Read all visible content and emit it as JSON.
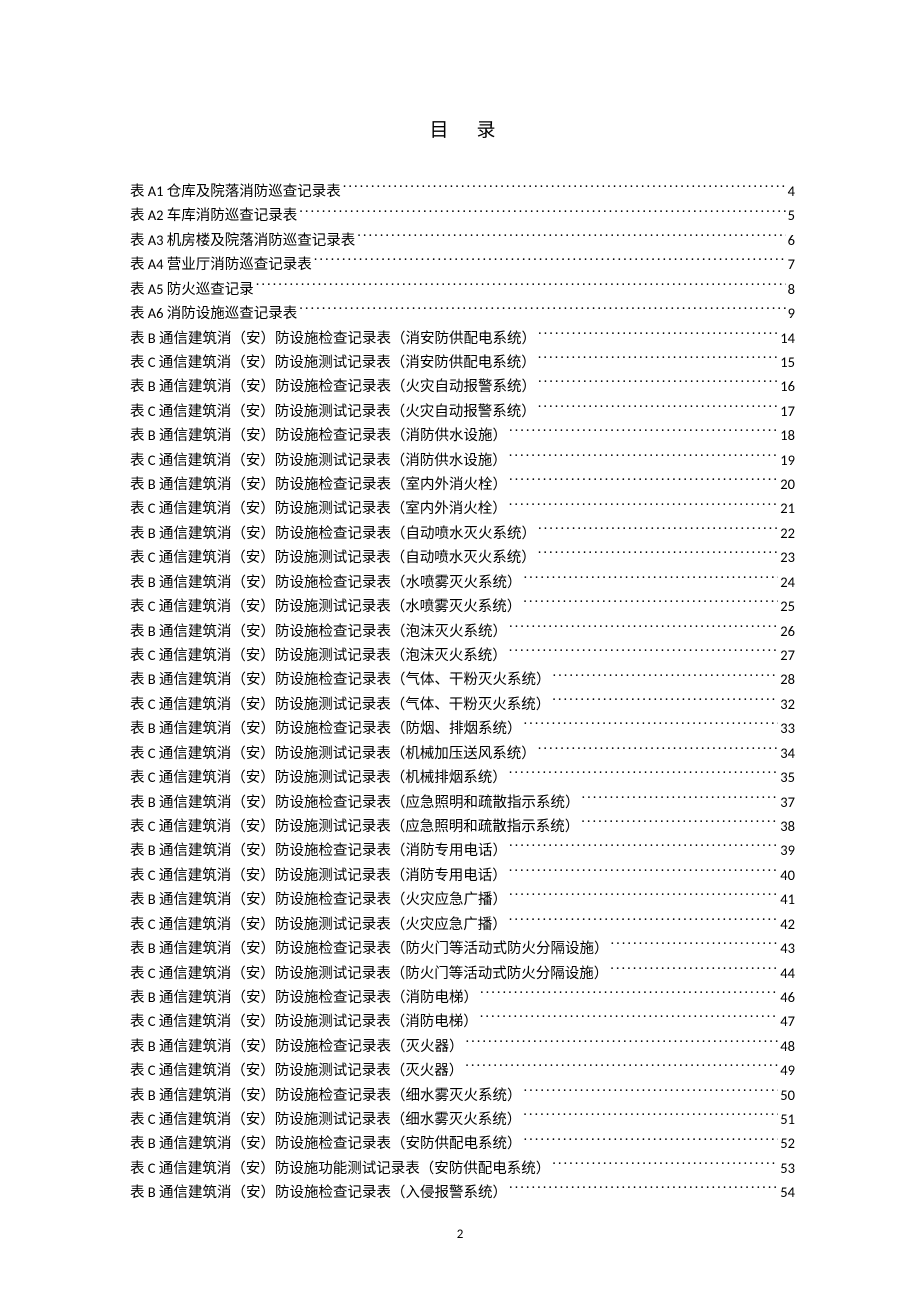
{
  "title": "目录",
  "page_number": "2",
  "toc": [
    {
      "text": "表 A1 仓库及院落消防巡查记录表",
      "page": "4"
    },
    {
      "text": "表 A2 车库消防巡查记录表",
      "page": "5"
    },
    {
      "text": "表 A3 机房楼及院落消防巡查记录表",
      "page": "6"
    },
    {
      "text": "表 A4 营业厅消防巡查记录表",
      "page": "7"
    },
    {
      "text": "表 A5 防火巡查记录",
      "page": "8"
    },
    {
      "text": "表 A6 消防设施巡查记录表",
      "page": "9"
    },
    {
      "text": "表 B 通信建筑消（安）防设施检查记录表（消安防供配电系统）",
      "page": "14"
    },
    {
      "text": "表 C 通信建筑消（安）防设施测试记录表（消安防供配电系统）",
      "page": "15"
    },
    {
      "text": "表 B 通信建筑消（安）防设施检查记录表（火灾自动报警系统）",
      "page": "16"
    },
    {
      "text": "表 C 通信建筑消（安）防设施测试记录表（火灾自动报警系统）",
      "page": "17"
    },
    {
      "text": "表 B 通信建筑消（安）防设施检查记录表（消防供水设施）",
      "page": "18"
    },
    {
      "text": "表 C 通信建筑消（安）防设施测试记录表（消防供水设施）",
      "page": "19"
    },
    {
      "text": "表 B 通信建筑消（安）防设施检查记录表（室内外消火栓）",
      "page": "20"
    },
    {
      "text": "表 C 通信建筑消（安）防设施测试记录表（室内外消火栓）",
      "page": "21"
    },
    {
      "text": "表 B 通信建筑消（安）防设施检查记录表（自动喷水灭火系统）",
      "page": "22"
    },
    {
      "text": "表 C 通信建筑消（安）防设施测试记录表（自动喷水灭火系统）",
      "page": "23"
    },
    {
      "text": "表 B 通信建筑消（安）防设施检查记录表（水喷雾灭火系统）",
      "page": "24"
    },
    {
      "text": "表 C 通信建筑消（安）防设施测试记录表（水喷雾灭火系统）",
      "page": "25"
    },
    {
      "text": "表 B 通信建筑消（安）防设施检查记录表（泡沫灭火系统）",
      "page": "26"
    },
    {
      "text": "表 C 通信建筑消（安）防设施测试记录表（泡沫灭火系统）",
      "page": "27"
    },
    {
      "text": "表 B 通信建筑消（安）防设施检查记录表（气体、干粉灭火系统）",
      "page": "28"
    },
    {
      "text": "表 C 通信建筑消（安）防设施测试记录表（气体、干粉灭火系统）",
      "page": "32"
    },
    {
      "text": "表 B 通信建筑消（安）防设施检查记录表（防烟、排烟系统）",
      "page": "33"
    },
    {
      "text": "表 C 通信建筑消（安）防设施测试记录表（机械加压送风系统）",
      "page": "34"
    },
    {
      "text": "表 C 通信建筑消（安）防设施测试记录表（机械排烟系统）",
      "page": "35"
    },
    {
      "text": "表 B 通信建筑消（安）防设施检查记录表（应急照明和疏散指示系统）",
      "page": "37"
    },
    {
      "text": "表 C 通信建筑消（安）防设施测试记录表（应急照明和疏散指示系统）",
      "page": "38"
    },
    {
      "text": "表 B 通信建筑消（安）防设施检查记录表（消防专用电话）",
      "page": "39"
    },
    {
      "text": "表 C 通信建筑消（安）防设施测试记录表（消防专用电话）",
      "page": "40"
    },
    {
      "text": "表 B 通信建筑消（安）防设施检查记录表（火灾应急广播）",
      "page": "41"
    },
    {
      "text": "表 C 通信建筑消（安）防设施测试记录表（火灾应急广播）",
      "page": "42"
    },
    {
      "text": "表 B 通信建筑消（安）防设施检查记录表（防火门等活动式防火分隔设施）",
      "page": "43"
    },
    {
      "text": "表 C 通信建筑消（安）防设施测试记录表（防火门等活动式防火分隔设施）",
      "page": "44"
    },
    {
      "text": "表 B 通信建筑消（安）防设施检查记录表（消防电梯）",
      "page": "46"
    },
    {
      "text": "表 C 通信建筑消（安）防设施测试记录表（消防电梯）",
      "page": "47"
    },
    {
      "text": "表 B 通信建筑消（安）防设施检查记录表（灭火器）",
      "page": "48"
    },
    {
      "text": "表 C 通信建筑消（安）防设施测试记录表（灭火器）",
      "page": "49"
    },
    {
      "text": "表 B 通信建筑消（安）防设施检查记录表（细水雾灭火系统）",
      "page": "50"
    },
    {
      "text": "表 C 通信建筑消（安）防设施测试记录表（细水雾灭火系统）",
      "page": "51"
    },
    {
      "text": "表 B 通信建筑消（安）防设施检查记录表（安防供配电系统）",
      "page": "52"
    },
    {
      "text": "表 C 通信建筑消（安）防设施功能测试记录表（安防供配电系统）",
      "page": "53"
    },
    {
      "text": "表 B 通信建筑消（安）防设施检查记录表（入侵报警系统）",
      "page": "54"
    }
  ]
}
